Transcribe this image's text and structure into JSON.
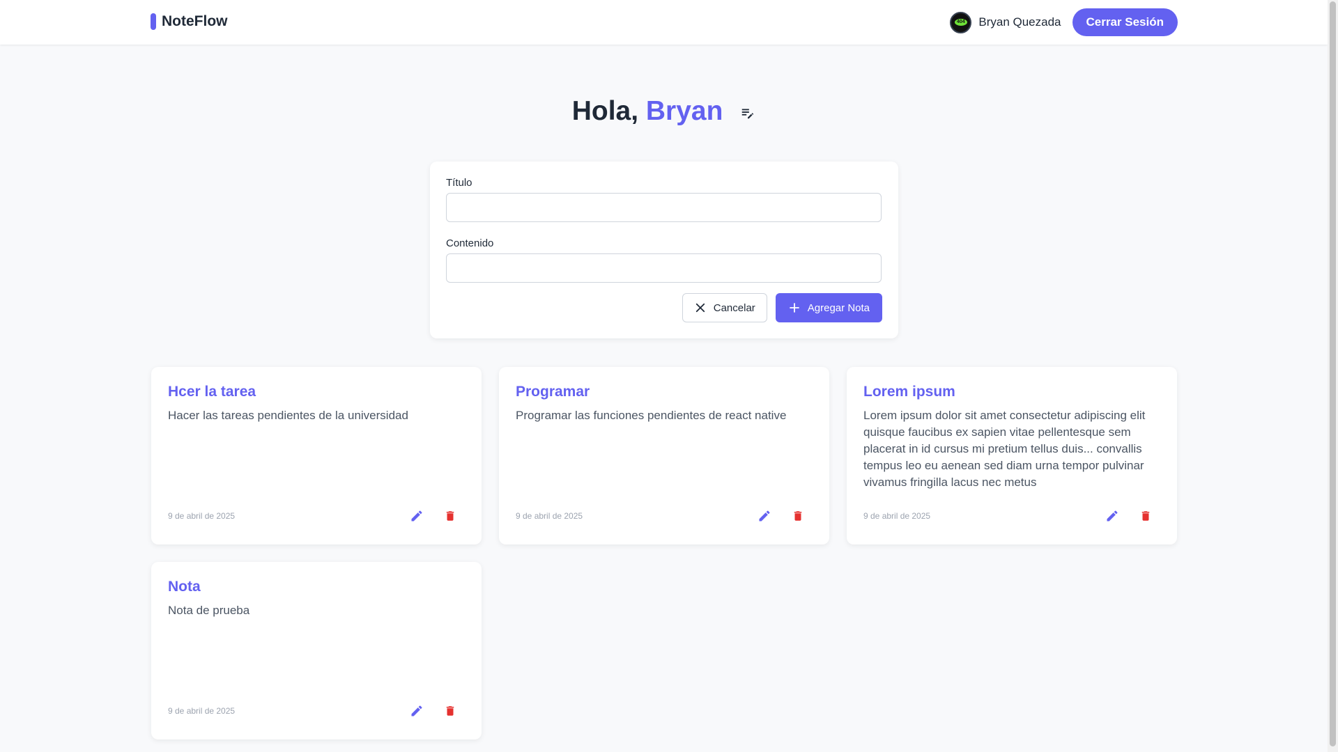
{
  "app": {
    "brand": "NoteFlow"
  },
  "header": {
    "user_name": "Bryan Quezada",
    "avatar_text": "404",
    "logout_label": "Cerrar Sesión"
  },
  "greeting": {
    "prefix": "Hola, ",
    "name": "Bryan"
  },
  "form": {
    "title_label": "Título",
    "title_value": "",
    "content_label": "Contenido",
    "content_value": "",
    "cancel_label": "Cancelar",
    "add_label": "Agregar Nota"
  },
  "notes": [
    {
      "title": "Hcer la tarea",
      "content": "Hacer las tareas pendientes de la universidad",
      "date": "9 de abril de 2025"
    },
    {
      "title": "Programar",
      "content": "Programar las funciones pendientes de react native",
      "date": "9 de abril de 2025"
    },
    {
      "title": "Lorem ipsum",
      "content": "Lorem ipsum dolor sit amet consectetur adipiscing elit quisque faucibus ex sapien vitae pellentesque sem placerat in id cursus mi pretium tellus duis... convallis tempus leo eu aenean sed diam urna tempor pulvinar vivamus fringilla lacus nec metus",
      "date": "9 de abril de 2025"
    },
    {
      "title": "Nota",
      "content": "Nota de prueba",
      "date": "9 de abril de 2025"
    }
  ],
  "icons": {
    "edit": "pencil-icon",
    "delete": "trash-icon",
    "cancel": "close-icon",
    "add": "plus-icon",
    "greeting": "edit-list-icon"
  },
  "colors": {
    "accent": "#6361f0",
    "delete": "#e5312f",
    "background": "#f8f9fb"
  }
}
